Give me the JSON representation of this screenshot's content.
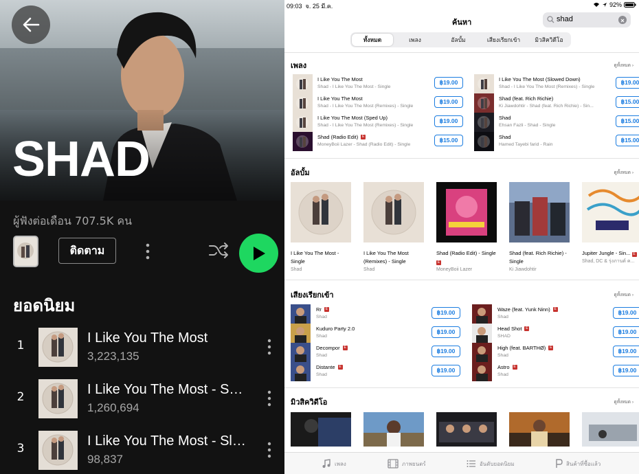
{
  "spotify": {
    "artist_name": "SHAD",
    "monthly_listeners": "ผู้ฟังต่อเดือน 707.5K คน",
    "follow_label": "ติดตาม",
    "popular_title": "ยอดนิยม",
    "tracks": [
      {
        "num": "1",
        "title": "I Like You The Most",
        "plays": "3,223,135"
      },
      {
        "num": "2",
        "title": "I Like You The Most - Sped Up",
        "plays": "1,260,694"
      },
      {
        "num": "3",
        "title": "I Like You The Most - Slowed Down",
        "plays": "98,837"
      }
    ],
    "colors": {
      "accent": "#1ed760",
      "background": "#121212"
    }
  },
  "itunes": {
    "status": {
      "time": "09:03",
      "date": "จ. 25 มี.ค.",
      "battery": "92%"
    },
    "nav_title": "ค้นหา",
    "search_value": "shad",
    "segments": [
      "ทั้งหมด",
      "เพลง",
      "อัลบั้ม",
      "เสียงเรียกเข้า",
      "มิวสิควิดีโอ"
    ],
    "see_all": "ดูทั้งหมด",
    "songs": {
      "title": "เพลง",
      "items": [
        {
          "title": "I Like You The Most",
          "sub": "Shad - I Like You The Most - Single",
          "price": "฿19.00",
          "explicit": false
        },
        {
          "title": "I Like You The Most",
          "sub": "Shad - I Like You The Most (Remixes) - Single",
          "price": "฿19.00",
          "explicit": false
        },
        {
          "title": "I Like You The Most (Sped Up)",
          "sub": "Shad - I Like You The Most (Remixes) - Single",
          "price": "฿19.00",
          "explicit": false
        },
        {
          "title": "Shad (Radio Edit)",
          "sub": "MoneyBoii Lazer - Shad (Radio Edit) - Single",
          "price": "฿15.00",
          "explicit": true
        },
        {
          "title": "I Like You The Most (Slowed Down)",
          "sub": "Shad - I Like You The Most (Remixes) - Single",
          "price": "฿19.00",
          "explicit": false
        },
        {
          "title": "Shad (feat. Rich Richie)",
          "sub": "Ki Jiawdohtir - Shad (feat. Rich Richie) - Sin...",
          "price": "฿15.00",
          "explicit": false
        },
        {
          "title": "Shad",
          "sub": "Ehsan Fazli - Shad - Single",
          "price": "฿15.00",
          "explicit": false
        },
        {
          "title": "Shad",
          "sub": "Hamed Tayebi farid - Rain",
          "price": "฿15.00",
          "explicit": false
        }
      ]
    },
    "albums": {
      "title": "อัลบั้ม",
      "items": [
        {
          "title": "I Like You The Most - Single",
          "artist": "Shad",
          "explicit": false
        },
        {
          "title": "I Like You The Most (Remixes) - Single",
          "artist": "Shad",
          "explicit": false
        },
        {
          "title": "Shad (Radio Edit) - Single",
          "artist": "MoneyBoii Lazer",
          "explicit": true
        },
        {
          "title": "Shad (feat. Rich Richie) - Single",
          "artist": "Ki Jiawdohtir",
          "explicit": false
        },
        {
          "title": "Jupiter Jungle - Sin...",
          "artist": "Shad, DC & รุ่งภานต์ ค...",
          "explicit": true
        }
      ]
    },
    "ringtones": {
      "title": "เสียงเรียกเข้า",
      "items": [
        {
          "title": "Rr",
          "artist": "Shad",
          "price": "฿19.00",
          "explicit": true
        },
        {
          "title": "Kuduro Party 2.0",
          "artist": "Shad",
          "price": "฿19.00",
          "explicit": false
        },
        {
          "title": "Decompor",
          "artist": "Shad",
          "price": "฿19.00",
          "explicit": true
        },
        {
          "title": "Distante",
          "artist": "Shad",
          "price": "฿19.00",
          "explicit": true
        },
        {
          "title": "Waze (feat. Yunk Ninn)",
          "artist": "Shad",
          "price": "฿19.00",
          "explicit": true
        },
        {
          "title": "Head Shot",
          "artist": "SHAD",
          "price": "฿19.00",
          "explicit": true
        },
        {
          "title": "High (feat. BARTHØ)",
          "artist": "Shad",
          "price": "฿19.00",
          "explicit": true
        },
        {
          "title": "Astro",
          "artist": "Shad",
          "price": "฿19.00",
          "explicit": true
        }
      ]
    },
    "music_videos": {
      "title": "มิวสิควิดีโอ"
    },
    "tabs": [
      "เพลง",
      "ภาพยนตร์",
      "อันดับยอดนิยม",
      "สินค้าที่ซื้อแล้ว"
    ]
  }
}
